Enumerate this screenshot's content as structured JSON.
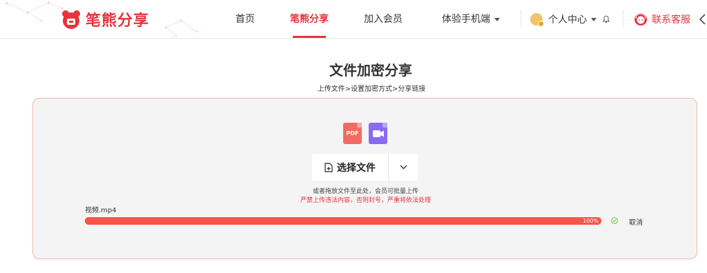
{
  "header": {
    "logo_text": "笔熊分享",
    "nav": [
      {
        "label": "首页"
      },
      {
        "label": "笔熊分享",
        "active": true
      },
      {
        "label": "加入会员"
      },
      {
        "label": "体验手机端"
      }
    ],
    "user_center": "个人中心",
    "service": "联系客服",
    "accent": "#e8323c"
  },
  "page": {
    "title": "文件加密分享",
    "steps": "上传文件>设置加密方式>分享链接"
  },
  "upload": {
    "file_type_icons": [
      {
        "icon": "pdf-icon",
        "label": "PDF",
        "color": "#f26b63"
      },
      {
        "icon": "video-icon",
        "color": "#8a6bf0"
      }
    ],
    "select_label": "选择文件",
    "hint": "或者拖放文件至此处，会员可批量上传",
    "warning": "严禁上传违法内容，否则封号，严重将依法处理",
    "file": {
      "name": "视频.mp4",
      "progress": 1.0,
      "progress_text": "100%",
      "status": "done",
      "cancel_label": "取消"
    }
  }
}
